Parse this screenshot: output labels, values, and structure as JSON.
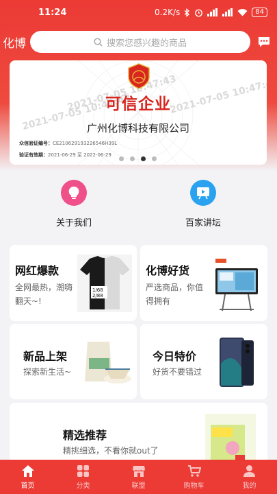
{
  "status_bar": {
    "time": "11:24",
    "network_speed": "0.2K/s",
    "battery": "84"
  },
  "header": {
    "brand": "化博",
    "search_placeholder": "搜索您感兴趣的商品"
  },
  "banner": {
    "watermark": "2021-07-05 10:47:43",
    "title": "可信企业",
    "company": "广州化博科技有限公司",
    "verify_code_label": "众信验证编号：",
    "verify_code": "CE210629193226546H39L",
    "validity_label": "验证有效期：",
    "validity": "2021-06-29 至 2022-06-29",
    "logo_text": "EBS"
  },
  "quick_nav": [
    {
      "label": "关于我们",
      "icon": "lightbulb-icon",
      "color": "#f0508a"
    },
    {
      "label": "百家讲坛",
      "icon": "video-board-icon",
      "color": "#2aa2f0"
    }
  ],
  "cards": {
    "hot": {
      "title": "网红爆款",
      "subtitle_1": "全网最热，潮嗨",
      "subtitle_2": "翻天~!"
    },
    "good": {
      "title": "化博好货",
      "subtitle_1": "严选商品，你值",
      "subtitle_2": "得拥有"
    },
    "new": {
      "title": "新品上架",
      "subtitle": "探索新生活~"
    },
    "deal": {
      "title": "今日特价",
      "subtitle": "好货不要错过"
    },
    "pick": {
      "title": "精选推荐",
      "subtitle": "精挑细选，不看你就out了"
    }
  },
  "tabs": [
    {
      "label": "首页",
      "icon": "home-icon",
      "active": true
    },
    {
      "label": "分类",
      "icon": "grid-icon",
      "active": false
    },
    {
      "label": "联盟",
      "icon": "store-icon",
      "active": false
    },
    {
      "label": "购物车",
      "icon": "cart-icon",
      "active": false
    },
    {
      "label": "我的",
      "icon": "user-icon",
      "active": false
    }
  ],
  "colors": {
    "brand_red": "#ec3a35",
    "credit_red": "#d8261f"
  }
}
